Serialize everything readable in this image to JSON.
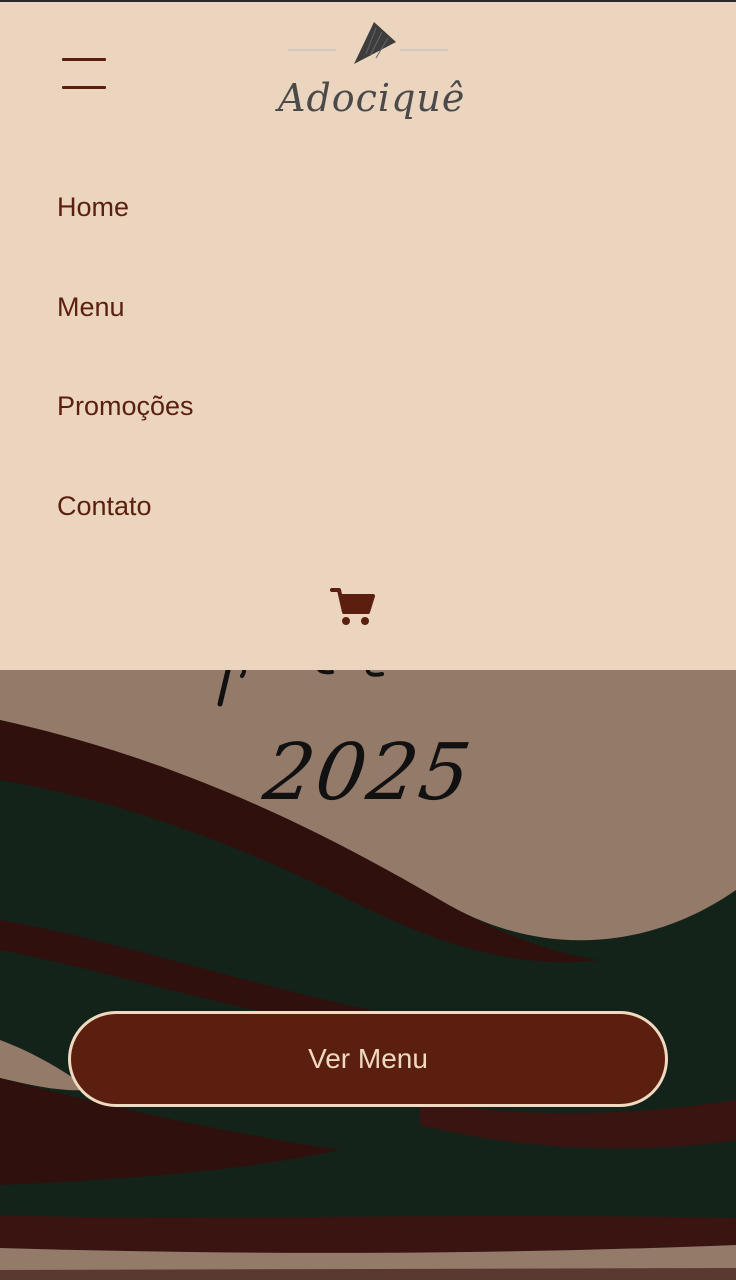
{
  "app": {
    "brand_name": "Adociquê"
  },
  "hero": {
    "year_text": "2025",
    "cta_label": "Ver Menu"
  },
  "nav": {
    "items": [
      {
        "label": "Home"
      },
      {
        "label": "Menu"
      },
      {
        "label": "Promoções"
      },
      {
        "label": "Contato"
      }
    ]
  },
  "icons": {
    "menu": "hamburger-icon",
    "cart": "cart-icon",
    "logo_mark": "cone-icon"
  },
  "colors": {
    "panel_bg": "#ecd5bf",
    "accent_brown": "#5a1f0e",
    "dark_green": "#13231a",
    "taupe": "#947a69",
    "cta_border": "#f0d9c0"
  }
}
